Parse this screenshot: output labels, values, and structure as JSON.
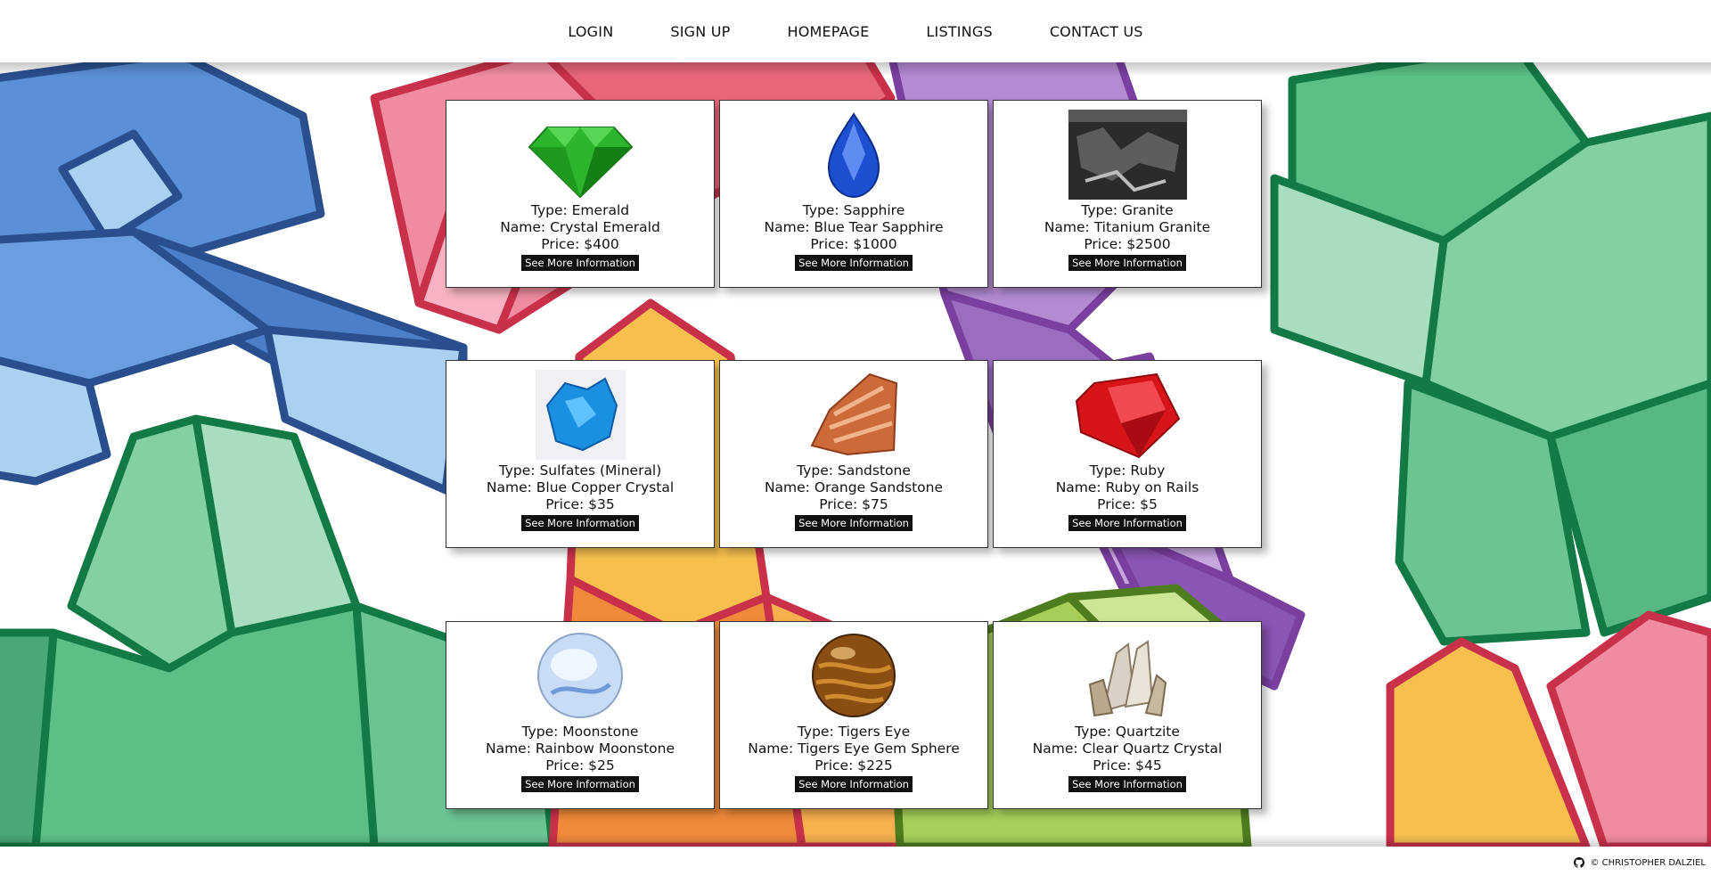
{
  "nav": {
    "items": [
      "LOGIN",
      "SIGN UP",
      "HOMEPAGE",
      "LISTINGS",
      "CONTACT US"
    ]
  },
  "listings": [
    {
      "type": "Type: Emerald",
      "name": "Name: Crystal Emerald",
      "price": "Price: $400",
      "button": "See More Information",
      "icon": "emerald-icon"
    },
    {
      "type": "Type: Sapphire",
      "name": "Name: Blue Tear Sapphire",
      "price": "Price: $1000",
      "button": "See More Information",
      "icon": "sapphire-icon"
    },
    {
      "type": "Type: Granite",
      "name": "Name: Titanium Granite",
      "price": "Price: $2500",
      "button": "See More Information",
      "icon": "granite-icon"
    },
    {
      "type": "Type: Sulfates (Mineral)",
      "name": "Name: Blue Copper Crystal",
      "price": "Price: $35",
      "button": "See More Information",
      "icon": "blue-copper-icon"
    },
    {
      "type": "Type: Sandstone",
      "name": "Name: Orange Sandstone",
      "price": "Price: $75",
      "button": "See More Information",
      "icon": "sandstone-icon"
    },
    {
      "type": "Type: Ruby",
      "name": "Name: Ruby on Rails",
      "price": "Price: $5",
      "button": "See More Information",
      "icon": "ruby-icon"
    },
    {
      "type": "Type: Moonstone",
      "name": "Name: Rainbow Moonstone",
      "price": "Price: $25",
      "button": "See More Information",
      "icon": "moonstone-icon"
    },
    {
      "type": "Type: Tigers Eye",
      "name": "Name: Tigers Eye Gem Sphere",
      "price": "Price: $225",
      "button": "See More Information",
      "icon": "tigers-eye-icon"
    },
    {
      "type": "Type: Quartzite",
      "name": "Name: Clear Quartz Crystal",
      "price": "Price: $45",
      "button": "See More Information",
      "icon": "quartz-icon"
    }
  ],
  "footer": {
    "text": "© CHRISTOPHER DALZIEL",
    "icon": "github-icon"
  },
  "colors": {
    "nav_bg": "#ffffff",
    "button_bg": "#111111",
    "crystal_blue": "#5b8fd6",
    "crystal_green": "#5cbf85",
    "crystal_red": "#e8667a",
    "crystal_purple": "#9b6cc0",
    "crystal_yellow": "#f7c04e",
    "crystal_orange": "#f08a3a",
    "crystal_lime": "#a6cf5a"
  }
}
